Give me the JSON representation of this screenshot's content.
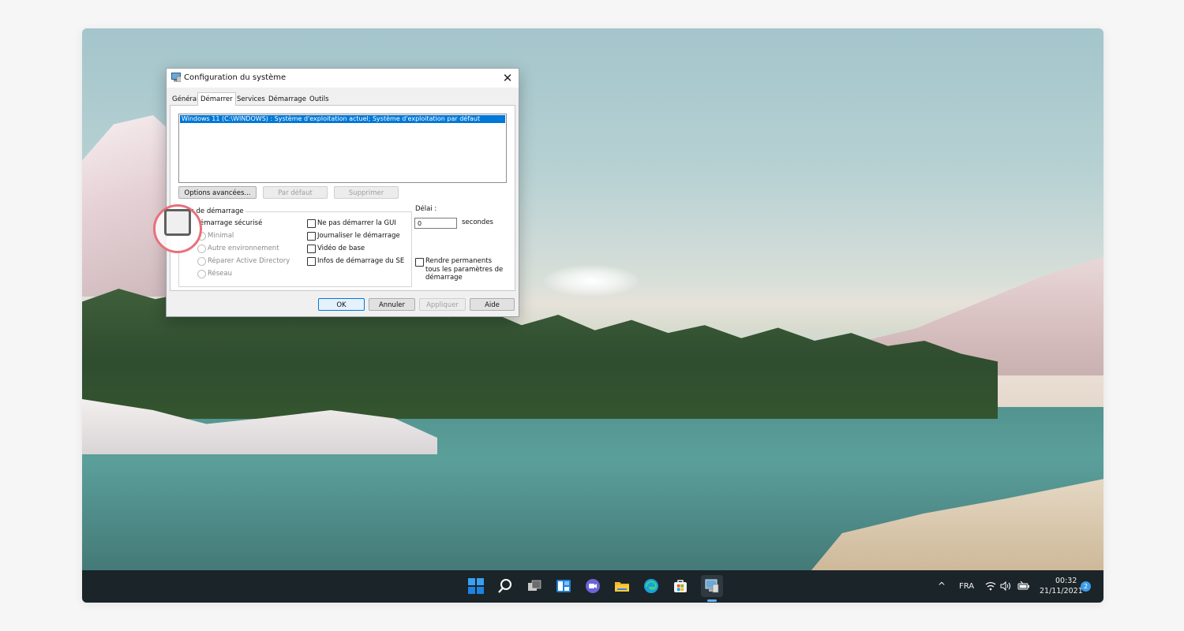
{
  "dialog": {
    "title": "Configuration du système",
    "close_glyph": "✕",
    "tabs": [
      "Général",
      "Démarrer",
      "Services",
      "Démarrage",
      "Outils"
    ],
    "os_list": [
      "Windows 11 (C:\\WINDOWS) : Système d'exploitation actuel; Système d'exploitation par défaut"
    ],
    "buttons": {
      "advanced": "Options avancées...",
      "default": "Par défaut",
      "delete": "Supprimer"
    },
    "boot_options": {
      "legend": "ns de démarrage",
      "safe_boot": "émarrage sécurisé",
      "radios": [
        "Minimal",
        "Autre environnement",
        "Réparer Active Directory",
        "Réseau"
      ],
      "checkboxes": [
        "Ne pas démarrer la GUI",
        "Journaliser le démarrage",
        "Vidéo de base",
        "Infos de démarrage du SE"
      ]
    },
    "timeout": {
      "label": "Délai :",
      "value": "0",
      "unit": "secondes"
    },
    "permanent": "Rendre permanents tous les paramètres de démarrage",
    "footer": {
      "ok": "OK",
      "cancel": "Annuler",
      "apply": "Appliquer",
      "help": "Aide"
    }
  },
  "taskbar": {
    "icons": [
      "windows-start-icon",
      "search-icon",
      "task-view-icon",
      "widgets-icon",
      "teams-chat-icon",
      "file-explorer-icon",
      "edge-browser-icon",
      "store-icon",
      "msconfig-app-icon"
    ],
    "tray": {
      "chevron": "^",
      "language": "FRA",
      "time": "00:32",
      "date": "21/11/2021",
      "notifications": "2"
    }
  },
  "colors": {
    "highlight": "#e8707c",
    "selection": "#0078d7",
    "taskbar": "#1b2429"
  }
}
